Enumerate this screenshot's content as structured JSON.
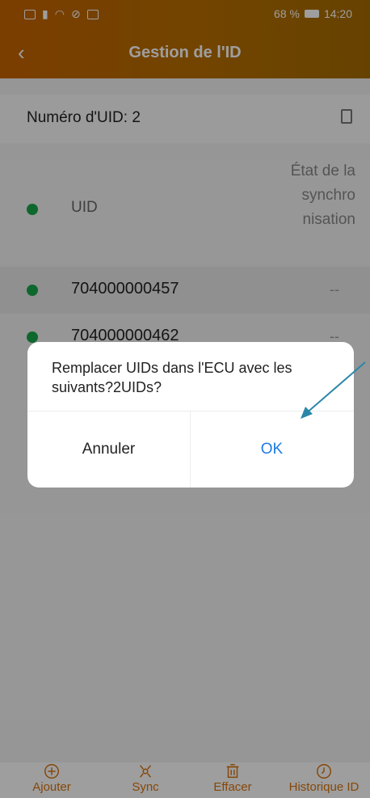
{
  "status_bar": {
    "battery_percent": "68 %",
    "time": "14:20",
    "left_icons": [
      "mail-icon",
      "signal-icon",
      "wifi-icon",
      "alarm-icon",
      "image-icon"
    ]
  },
  "header": {
    "title": "Gestion de l'ID",
    "back_icon": "chevron-left-icon"
  },
  "uid_count": {
    "label": "Numéro d'UID: 2",
    "icon": "copy-icon"
  },
  "table": {
    "header": {
      "uid_label": "UID",
      "state_label": "État de la synchro nisation"
    },
    "rows": [
      {
        "uid": "704000000457",
        "state": "--"
      },
      {
        "uid": "704000000462",
        "state": "--"
      }
    ]
  },
  "dialog": {
    "message": "Remplacer UIDs dans l'ECU avec les suivants?2UIDs?",
    "cancel_label": "Annuler",
    "ok_label": "OK"
  },
  "bottom_bar": {
    "tabs": [
      {
        "label": "Ajouter",
        "icon": "plus-circle-icon"
      },
      {
        "label": "Sync",
        "icon": "sync-network-icon"
      },
      {
        "label": "Effacer",
        "icon": "trash-icon"
      },
      {
        "label": "Historique ID",
        "icon": "clock-icon"
      }
    ]
  },
  "colors": {
    "accent": "#d9730f",
    "header": "#c56400",
    "ok_blue": "#1e7be6",
    "status_green": "#17a64a"
  }
}
